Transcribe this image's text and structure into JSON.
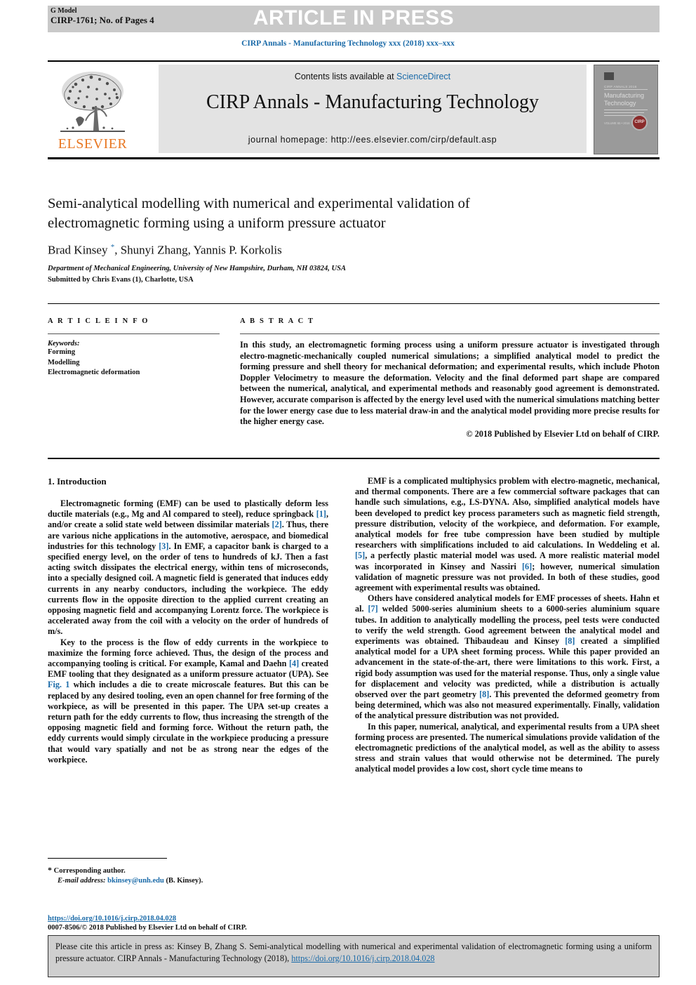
{
  "header": {
    "g_model_line1": "G Model",
    "g_model_line2": "CIRP-1761; No. of Pages 4",
    "press_banner": "ARTICLE IN PRESS",
    "journal_running_head": "CIRP Annals - Manufacturing Technology xxx (2018) xxx–xxx"
  },
  "masthead": {
    "contents_prefix": "Contents lists available at ",
    "sciencedirect": "ScienceDirect",
    "journal_title": "CIRP Annals - Manufacturing Technology",
    "homepage": "journal homepage: http://ees.elsevier.com/cirp/default.asp",
    "publisher_logo_text": "ELSEVIER",
    "cover": {
      "eyebrow": "CIRP ANNALS 2016",
      "title_line1": "Manufacturing",
      "title_line2": "Technology",
      "volume_text": "VOLUME 65 • 2016",
      "seal_text": "CIRP"
    }
  },
  "article": {
    "title": "Semi-analytical modelling with numerical and experimental validation of electromagnetic forming using a uniform pressure actuator",
    "authors": "Brad Kinsey *, Shunyi Zhang, Yannis P. Korkolis",
    "affiliation": "Department of Mechanical Engineering, University of New Hampshire, Durham, NH 03824, USA",
    "submitted_by": "Submitted by Chris Evans (1), Charlotte, USA"
  },
  "article_info": {
    "heading": "A R T I C L E   I N F O",
    "keywords_label": "Keywords:",
    "keywords": [
      "Forming",
      "Modelling",
      "Electromagnetic deformation"
    ]
  },
  "abstract": {
    "heading": "A B S T R A C T",
    "text": "In this study, an electromagnetic forming process using a uniform pressure actuator is investigated through electro-magnetic-mechanically coupled numerical simulations; a simplified analytical model to predict the forming pressure and shell theory for mechanical deformation; and experimental results, which include Photon Doppler Velocimetry to measure the deformation. Velocity and the final deformed part shape are compared between the numerical, analytical, and experimental methods and reasonably good agreement is demonstrated. However, accurate comparison is affected by the energy level used with the numerical simulations matching better for the lower energy case due to less material draw-in and the analytical model providing more precise results for the higher energy case.",
    "copyright": "© 2018 Published by Elsevier Ltd on behalf of CIRP."
  },
  "body": {
    "section1_heading": "1. Introduction",
    "left_paragraphs": [
      "Electromagnetic forming (EMF) can be used to plastically deform less ductile materials (e.g., Mg and Al compared to steel), reduce springback [1], and/or create a solid state weld between dissimilar materials [2]. Thus, there are various niche applications in the automotive, aerospace, and biomedical industries for this technology [3]. In EMF, a capacitor bank is charged to a specified energy level, on the order of tens to hundreds of kJ. Then a fast acting switch dissipates the electrical energy, within tens of microseconds, into a specially designed coil. A magnetic field is generated that induces eddy currents in any nearby conductors, including the workpiece. The eddy currents flow in the opposite direction to the applied current creating an opposing magnetic field and accompanying Lorentz force. The workpiece is accelerated away from the coil with a velocity on the order of hundreds of m/s.",
      "Key to the process is the flow of eddy currents in the workpiece to maximize the forming force achieved. Thus, the design of the process and accompanying tooling is critical. For example, Kamal and Daehn [4] created EMF tooling that they designated as a uniform pressure actuator (UPA). See Fig. 1 which includes a die to create microscale features. But this can be replaced by any desired tooling, even an open channel for free forming of the workpiece, as will be presented in this paper. The UPA set-up creates a return path for the eddy currents to flow, thus increasing the strength of the opposing magnetic field and forming force. Without the return path, the eddy currents would simply circulate in the workpiece producing a pressure that would vary spatially and not be as strong near the edges of the workpiece."
    ],
    "right_paragraphs": [
      "EMF is a complicated multiphysics problem with electro-magnetic, mechanical, and thermal components. There are a few commercial software packages that can handle such simulations, e.g., LS-DYNA. Also, simplified analytical models have been developed to predict key process parameters such as magnetic field strength, pressure distribution, velocity of the workpiece, and deformation. For example, analytical models for free tube compression have been studied by multiple researchers with simplifications included to aid calculations. In Weddeling et al. [5], a perfectly plastic material model was used. A more realistic material model was incorporated in Kinsey and Nassiri [6]; however, numerical simulation validation of magnetic pressure was not provided. In both of these studies, good agreement with experimental results was obtained.",
      "Others have considered analytical models for EMF processes of sheets. Hahn et al. [7] welded 5000-series aluminium sheets to a 6000-series aluminium square tubes. In addition to analytically modelling the process, peel tests were conducted to verify the weld strength. Good agreement between the analytical model and experiments was obtained. Thibaudeau and Kinsey [8] created a simplified analytical model for a UPA sheet forming process. While this paper provided an advancement in the state-of-the-art, there were limitations to this work. First, a rigid body assumption was used for the material response. Thus, only a single value for displacement and velocity was predicted, while a distribution is actually observed over the part geometry [8]. This prevented the deformed geometry from being determined, which was also not measured experimentally. Finally, validation of the analytical pressure distribution was not provided.",
      "In this paper, numerical, analytical, and experimental results from a UPA sheet forming process are presented. The numerical simulations provide validation of the electromagnetic predictions of the analytical model, as well as the ability to assess stress and strain values that would otherwise not be determined. The purely analytical model provides a low cost, short cycle time means to"
    ]
  },
  "footnote": {
    "corresponding": "Corresponding author.",
    "email_label": "E-mail address:",
    "email": "bkinsey@unh.edu",
    "email_suffix": "(B. Kinsey).",
    "doi": "https://doi.org/10.1016/j.cirp.2018.04.028",
    "issn": "0007-8506/© 2018 Published by Elsevier Ltd on behalf of CIRP."
  },
  "citation_box": {
    "text_part1": "Please cite this article in press as: Kinsey  B, Zhang  S. Semi-analytical modelling with numerical and experimental validation of electromagnetic forming using a uniform pressure actuator. CIRP Annals - Manufacturing Technology (2018), ",
    "link": "https://doi.org/10.1016/j.cirp.2018.04.028"
  },
  "colors": {
    "link_blue": "#1a6aa8",
    "elsevier_orange": "#e87722",
    "band_grey": "#c9c9c9",
    "masthead_grey": "#e3e3e3"
  }
}
